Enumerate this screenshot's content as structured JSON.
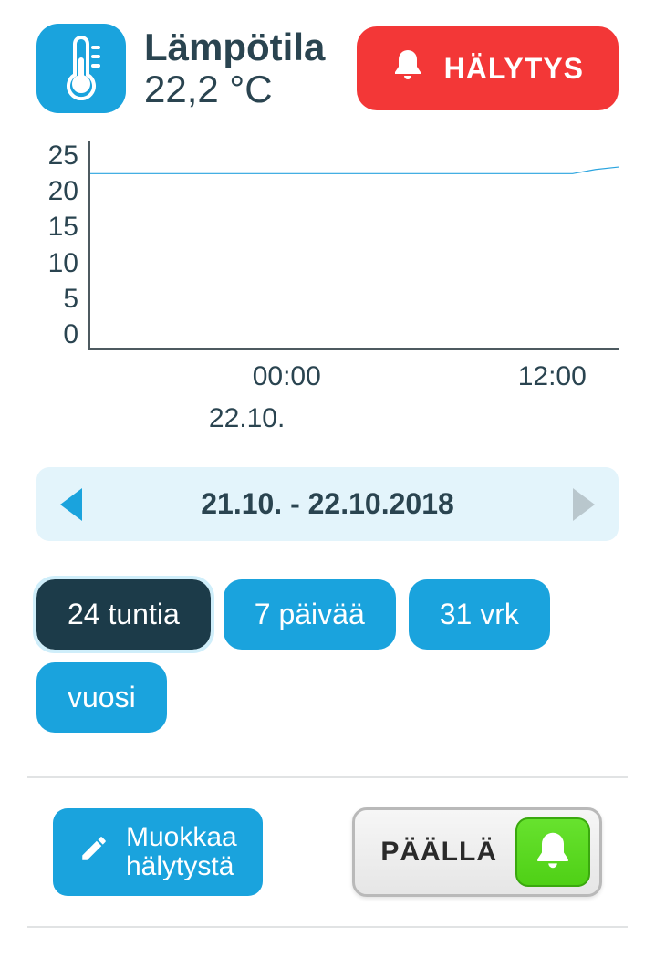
{
  "header": {
    "title": "Lämpötila",
    "value": "22,2 °C",
    "alert_label": "HÄLYTYS"
  },
  "chart_data": {
    "type": "line",
    "title": "",
    "xlabel": "",
    "ylabel": "",
    "ylim": [
      0,
      25
    ],
    "y_ticks": [
      "25",
      "20",
      "15",
      "10",
      "5",
      "0"
    ],
    "x_ticks": [
      "00:00",
      "12:00"
    ],
    "x_date": "22.10.",
    "series": [
      {
        "name": "Lämpötila",
        "values": [
          21,
          21,
          21,
          21,
          21,
          21,
          21,
          21,
          21,
          21,
          21,
          21,
          21,
          21,
          21,
          21,
          21,
          21,
          21,
          21,
          21,
          21,
          21.5,
          21.8
        ]
      }
    ]
  },
  "date_nav": {
    "range": "21.10. - 22.10.2018"
  },
  "ranges": {
    "items": [
      {
        "label": "24 tuntia",
        "active": true
      },
      {
        "label": "7 päivää",
        "active": false
      },
      {
        "label": "31 vrk",
        "active": false
      },
      {
        "label": "vuosi",
        "active": false
      }
    ]
  },
  "bottom": {
    "edit_line1": "Muokkaa",
    "edit_line2": "hälytystä",
    "toggle_label": "PÄÄLLÄ"
  }
}
